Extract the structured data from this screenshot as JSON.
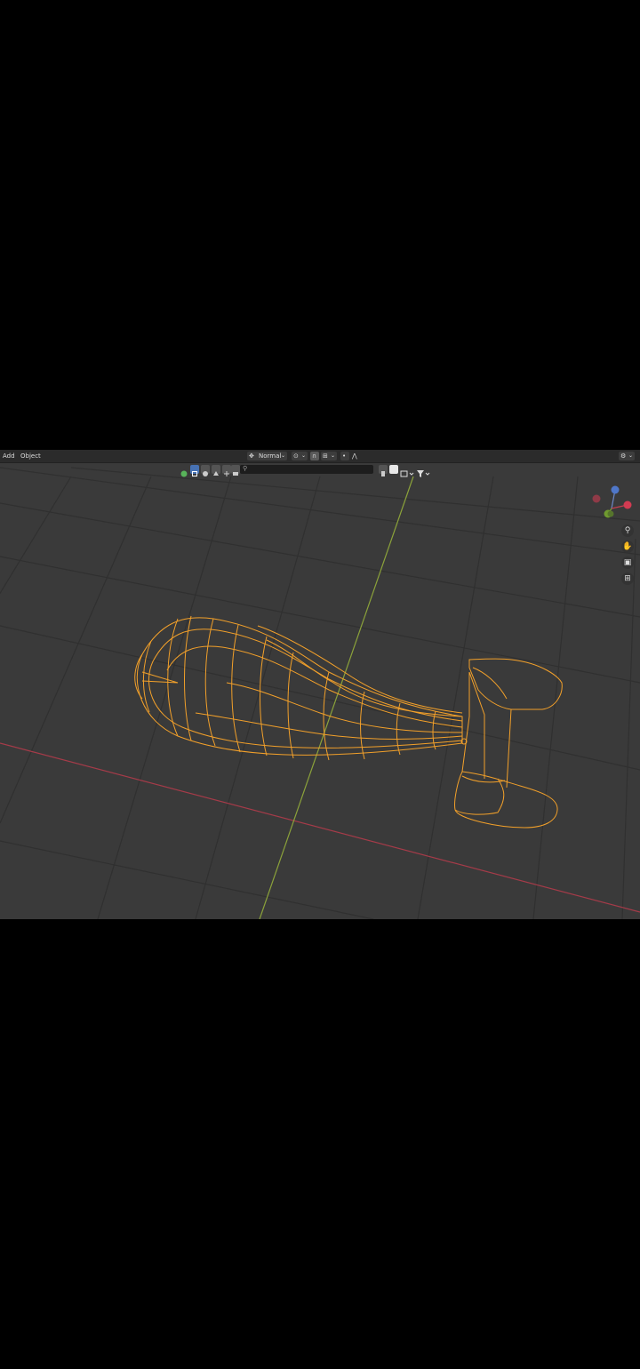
{
  "menu": {
    "add": "Add",
    "object": "Object"
  },
  "header": {
    "orientation_value": "Normal",
    "snap_icon": "magnet-icon",
    "proportional_icon": "falloff-icon",
    "overlay_icon": "overlay-icon"
  },
  "toolbar": {
    "filter_icons": [
      "sphere-icon",
      "cube-icon",
      "light-icon",
      "camera-icon",
      "empty-icon",
      "image-icon"
    ],
    "search_placeholder": "",
    "right_icons": [
      "bookmark-icon",
      "view-layer-icon",
      "filter-icon"
    ]
  },
  "gizmo": {
    "x_axis_label": "X",
    "y_axis_label": "Y",
    "z_axis_label": "Z"
  },
  "nav_buttons": [
    "zoom-icon",
    "hand-pan-icon",
    "camera-view-icon",
    "grid-perspective-icon"
  ],
  "colors": {
    "viewport_bg": "#3a3a3a",
    "grid_line": "#2f2f2f",
    "x_axis": "#b3404f",
    "y_axis": "#8fa33a",
    "selection_wire": "#f4a32c"
  }
}
